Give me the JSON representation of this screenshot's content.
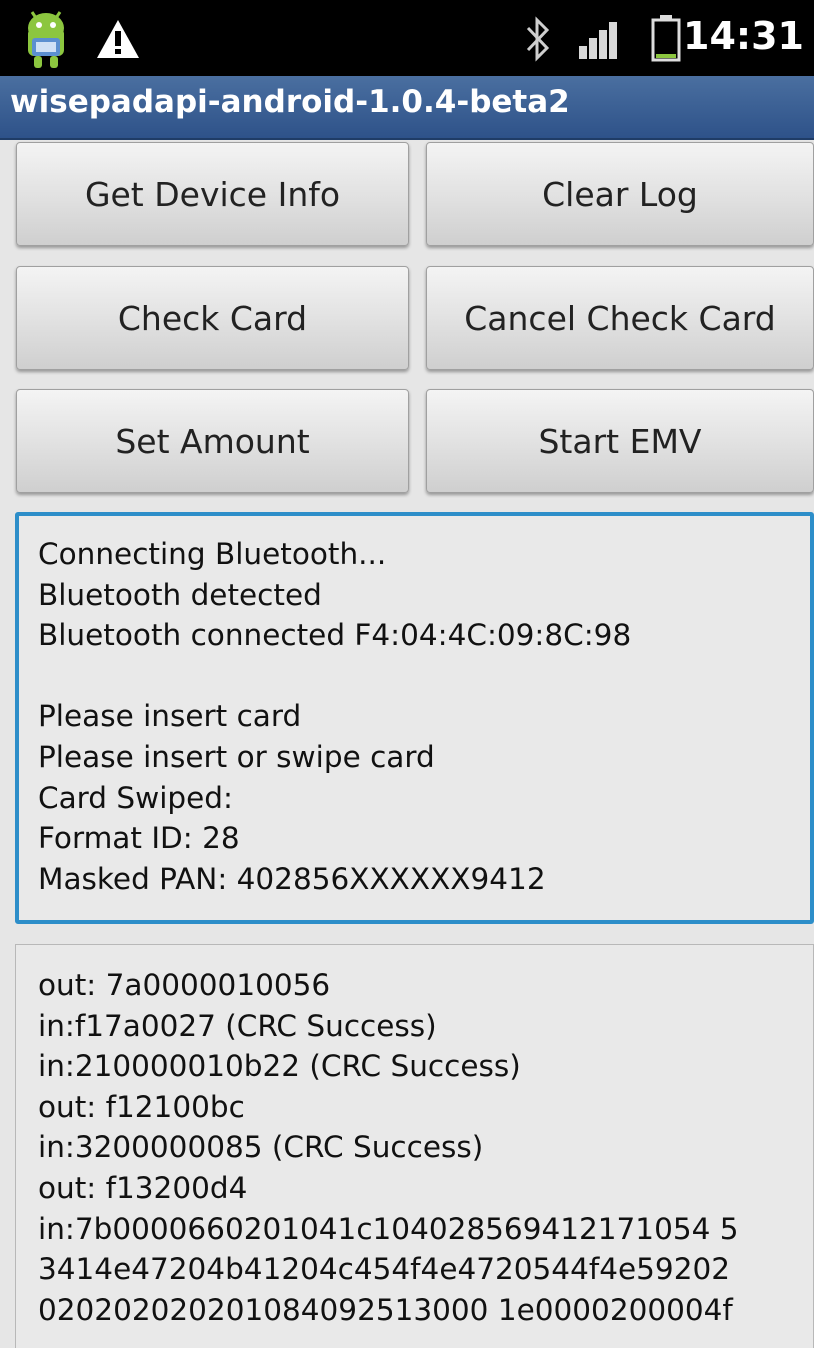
{
  "status_bar": {
    "icons": [
      "android-notification-icon",
      "warning-icon",
      "bluetooth-icon",
      "signal-icon",
      "battery-icon"
    ],
    "time": "14:31"
  },
  "app": {
    "title": "wisepadapi-android-1.0.4-beta2"
  },
  "buttons": {
    "get_device_info": "Get Device Info",
    "clear_log": "Clear Log",
    "check_card": "Check Card",
    "cancel_check_card": "Cancel Check Card",
    "set_amount": "Set Amount",
    "start_emv": "Start EMV"
  },
  "log": {
    "lines": [
      "Connecting Bluetooth...",
      "Bluetooth detected",
      "Bluetooth connected F4:04:4C:09:8C:98",
      "",
      "Please insert card",
      "Please insert or swipe card",
      "Card Swiped:",
      "Format ID: 28",
      "Masked PAN: 402856XXXXXX9412"
    ]
  },
  "comm_log": {
    "lines": [
      "out: 7a0000010056",
      "in:f17a0027 (CRC Success)",
      "in:210000010b22 (CRC Success)",
      "out: f12100bc",
      "in:3200000085 (CRC Success)",
      "out: f13200d4",
      "in:7b0000660201041c104028569412171054 5",
      "3414e47204b41204c454f4e4720544f4e59202",
      "020202020201084092513000 1e0000200004f"
    ]
  },
  "colors": {
    "title_bar": "#2e5289",
    "focused_border": "#2d8ec9",
    "battery_green": "#8cc63f"
  }
}
